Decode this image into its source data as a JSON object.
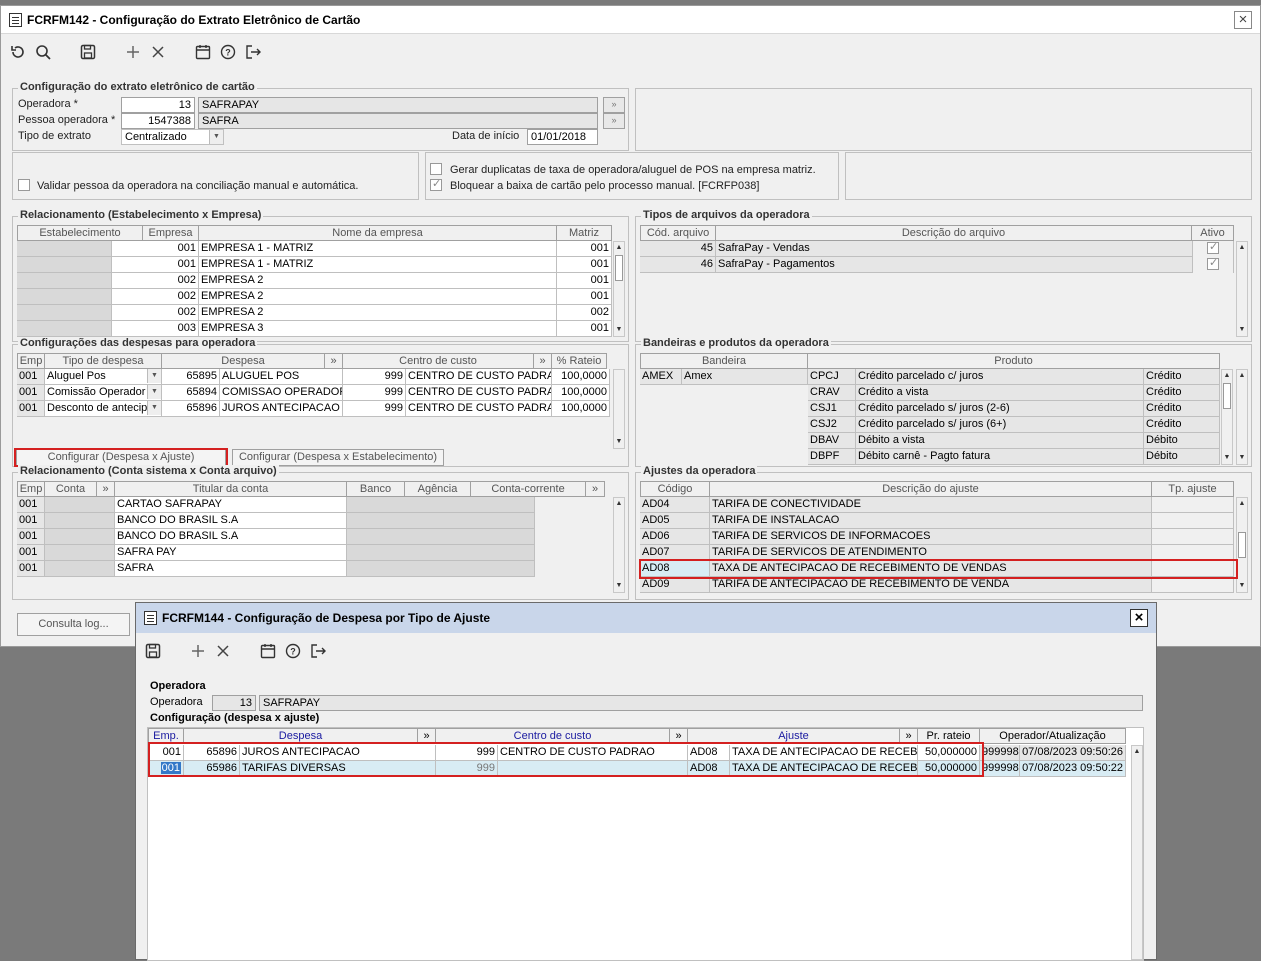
{
  "main_window": {
    "title": "FCRFM142 - Configuração do Extrato Eletrônico de Cartão",
    "config_group": {
      "title": "Configuração do extrato eletrônico de cartão",
      "operadora_label": "Operadora *",
      "operadora_code": "13",
      "operadora_name": "SAFRAPAY",
      "pessoa_label": "Pessoa operadora *",
      "pessoa_code": "1547388",
      "pessoa_name": "SAFRA",
      "tipo_label": "Tipo de extrato",
      "tipo_value": "Centralizado",
      "data_label": "Data de início",
      "data_value": "01/01/2018"
    },
    "options": {
      "validar": "Validar pessoa da operadora na conciliação manual e automática.",
      "gerar": "Gerar duplicatas de taxa de operadora/aluguel de POS na empresa matriz.",
      "bloquear": "Bloquear a baixa de cartão pelo processo manual. [FCRFP038]"
    },
    "relacionamento": {
      "title": "Relacionamento (Estabelecimento x Empresa)",
      "headers": [
        "Estabelecimento",
        "Empresa",
        "Nome da empresa",
        "Matriz"
      ],
      "rows": [
        [
          "",
          "001",
          "EMPRESA 1 - MATRIZ",
          "001"
        ],
        [
          "",
          "001",
          "EMPRESA 1 - MATRIZ",
          "001"
        ],
        [
          "",
          "002",
          "EMPRESA 2",
          "001"
        ],
        [
          "",
          "002",
          "EMPRESA 2",
          "001"
        ],
        [
          "",
          "002",
          "EMPRESA 2",
          "002"
        ],
        [
          "",
          "003",
          "EMPRESA 3",
          "001"
        ]
      ]
    },
    "tipos_arquivos": {
      "title": "Tipos de arquivos da operadora",
      "headers": [
        "Cód. arquivo",
        "Descrição do arquivo",
        "Ativo"
      ],
      "rows": [
        [
          "45",
          "SafraPay - Vendas"
        ],
        [
          "46",
          "SafraPay - Pagamentos"
        ]
      ]
    },
    "despesas": {
      "title": "Configurações das despesas para operadora",
      "headers": [
        "Emp",
        "Tipo de despesa",
        "Despesa",
        "Centro de custo",
        "% Rateio"
      ],
      "rows": [
        [
          "001",
          "Aluguel Pos",
          "65895",
          "ALUGUEL POS",
          "999",
          "CENTRO DE CUSTO PADRAO",
          "100,0000"
        ],
        [
          "001",
          "Comissão Operador",
          "65894",
          "COMISSAO OPERADORA",
          "999",
          "CENTRO DE CUSTO PADRAO",
          "100,0000"
        ],
        [
          "001",
          "Desconto de antecip",
          "65896",
          "JUROS ANTECIPACAO",
          "999",
          "CENTRO DE CUSTO PADRAO",
          "100,0000"
        ]
      ],
      "btn_ajuste": "Configurar (Despesa x Ajuste)",
      "btn_estab": "Configurar (Despesa x Estabelecimento)"
    },
    "bandeiras": {
      "title": "Bandeiras e produtos da operadora",
      "headers": [
        "Bandeira",
        "Produto"
      ],
      "bandeira_code": "AMEX",
      "bandeira_name": "Amex",
      "rows": [
        [
          "CPCJ",
          "Crédito parcelado c/ juros",
          "Crédito"
        ],
        [
          "CRAV",
          "Crédito a vista",
          "Crédito"
        ],
        [
          "CSJ1",
          "Crédito parcelado s/ juros (2-6)",
          "Crédito"
        ],
        [
          "CSJ2",
          "Crédito parcelado s/ juros (6+)",
          "Crédito"
        ],
        [
          "DBAV",
          "Débito a vista",
          "Débito"
        ],
        [
          "DBPF",
          "Débito carnê - Pagto fatura",
          "Débito"
        ]
      ]
    },
    "contas": {
      "title": "Relacionamento (Conta sistema x Conta arquivo)",
      "headers": [
        "Emp",
        "Conta",
        "Titular da conta",
        "Banco",
        "Agência",
        "Conta-corrente"
      ],
      "rows": [
        [
          "001",
          "CARTAO SAFRAPAY"
        ],
        [
          "001",
          "BANCO DO BRASIL S.A"
        ],
        [
          "001",
          "BANCO DO BRASIL S.A"
        ],
        [
          "001",
          "SAFRA PAY"
        ],
        [
          "001",
          "SAFRA"
        ]
      ]
    },
    "ajustes": {
      "title": "Ajustes da operadora",
      "headers": [
        "Código",
        "Descrição do ajuste",
        "Tp. ajuste"
      ],
      "rows": [
        [
          "AD04",
          "TARIFA DE CONECTIVIDADE"
        ],
        [
          "AD05",
          "TARIFA DE INSTALACAO"
        ],
        [
          "AD06",
          "TARIFA DE SERVICOS DE INFORMACOES"
        ],
        [
          "AD07",
          "TARIFA DE SERVICOS DE ATENDIMENTO"
        ],
        [
          "AD08",
          "TAXA DE ANTECIPACAO DE RECEBIMENTO DE VENDAS"
        ],
        [
          "AD09",
          "TARIFA DE ANTECIPACAO DE RECEBIMENTO DE VENDA"
        ]
      ]
    },
    "consulta_log": "Consulta log..."
  },
  "dialog": {
    "title": "FCRFM144 - Configuração de Despesa por Tipo de Ajuste",
    "operadora_group": "Operadora",
    "operadora_label": "Operadora",
    "operadora_code": "13",
    "operadora_name": "SAFRAPAY",
    "config_title": "Configuração (despesa x ajuste)",
    "headers": [
      "Emp.",
      "Despesa",
      "Centro de custo",
      "Ajuste",
      "Pr. rateio",
      "Operador/Atualização"
    ],
    "rows": [
      [
        "001",
        "65896",
        "JUROS ANTECIPACAO",
        "999",
        "CENTRO DE CUSTO PADRAO",
        "AD08",
        "TAXA DE ANTECIPACAO DE RECEBIME",
        "50,000000",
        "999998",
        "07/08/2023 09:50:26"
      ],
      [
        "001",
        "65986",
        "TARIFAS DIVERSAS",
        "999",
        "",
        "AD08",
        "TAXA DE ANTECIPACAO DE RECEBIME",
        "50,000000",
        "999998",
        "07/08/2023 09:50:22"
      ]
    ]
  },
  "colors": {
    "highlight": "#d42020",
    "selected_row": "#d8ecf4",
    "dialog_title": "#c9d6ea"
  }
}
